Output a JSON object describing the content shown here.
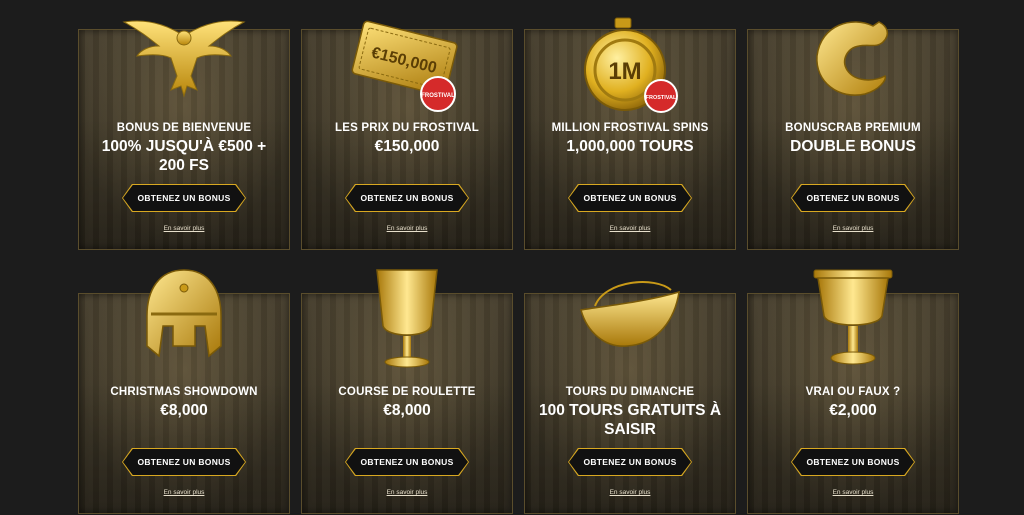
{
  "colors": {
    "background": "#1c1c1c",
    "gold_accent": "#d8a821",
    "card_border": "#5a4d2c",
    "badge_red": "#d52a2a"
  },
  "cards": [
    {
      "subtitle": "BONUS DE BIENVENUE",
      "headline": "100% JUSQU'À €500 + 200 FS",
      "button": "OBTENEZ UN BONUS",
      "link": "En savoir plus",
      "icon": "golden-eagle-icon"
    },
    {
      "subtitle": "LES PRIX DU FROSTIVAL",
      "headline": "€150,000",
      "button": "OBTENEZ UN BONUS",
      "link": "En savoir plus",
      "icon": "golden-ticket-icon",
      "art_text": "€150,000",
      "badge_text": "FROSTIVAL"
    },
    {
      "subtitle": "MILLION FROSTIVAL SPINS",
      "headline": "1,000,000 TOURS",
      "button": "OBTENEZ UN BONUS",
      "link": "En savoir plus",
      "icon": "golden-medal-icon",
      "art_text": "1M",
      "badge_text": "FROSTIVAL"
    },
    {
      "subtitle": "BONUSCRAB PREMIUM",
      "headline": "DOUBLE BONUS",
      "button": "OBTENEZ UN BONUS",
      "link": "En savoir plus",
      "icon": "golden-crab-claw-icon"
    },
    {
      "subtitle": "CHRISTMAS SHOWDOWN",
      "headline": "€8,000",
      "button": "OBTENEZ UN BONUS",
      "link": "En savoir plus",
      "icon": "golden-helmet-icon"
    },
    {
      "subtitle": "COURSE DE ROULETTE",
      "headline": "€8,000",
      "button": "OBTENEZ UN BONUS",
      "link": "En savoir plus",
      "icon": "golden-goblet-icon"
    },
    {
      "subtitle": "TOURS DU DIMANCHE",
      "headline": "100 TOURS GRATUITS À SAISIR",
      "button": "OBTENEZ UN BONUS",
      "link": "En savoir plus",
      "icon": "golden-boat-bowl-icon"
    },
    {
      "subtitle": "VRAI OU FAUX ?",
      "headline": "€2,000",
      "button": "OBTENEZ UN BONUS",
      "link": "En savoir plus",
      "icon": "golden-chalice-icon"
    }
  ]
}
